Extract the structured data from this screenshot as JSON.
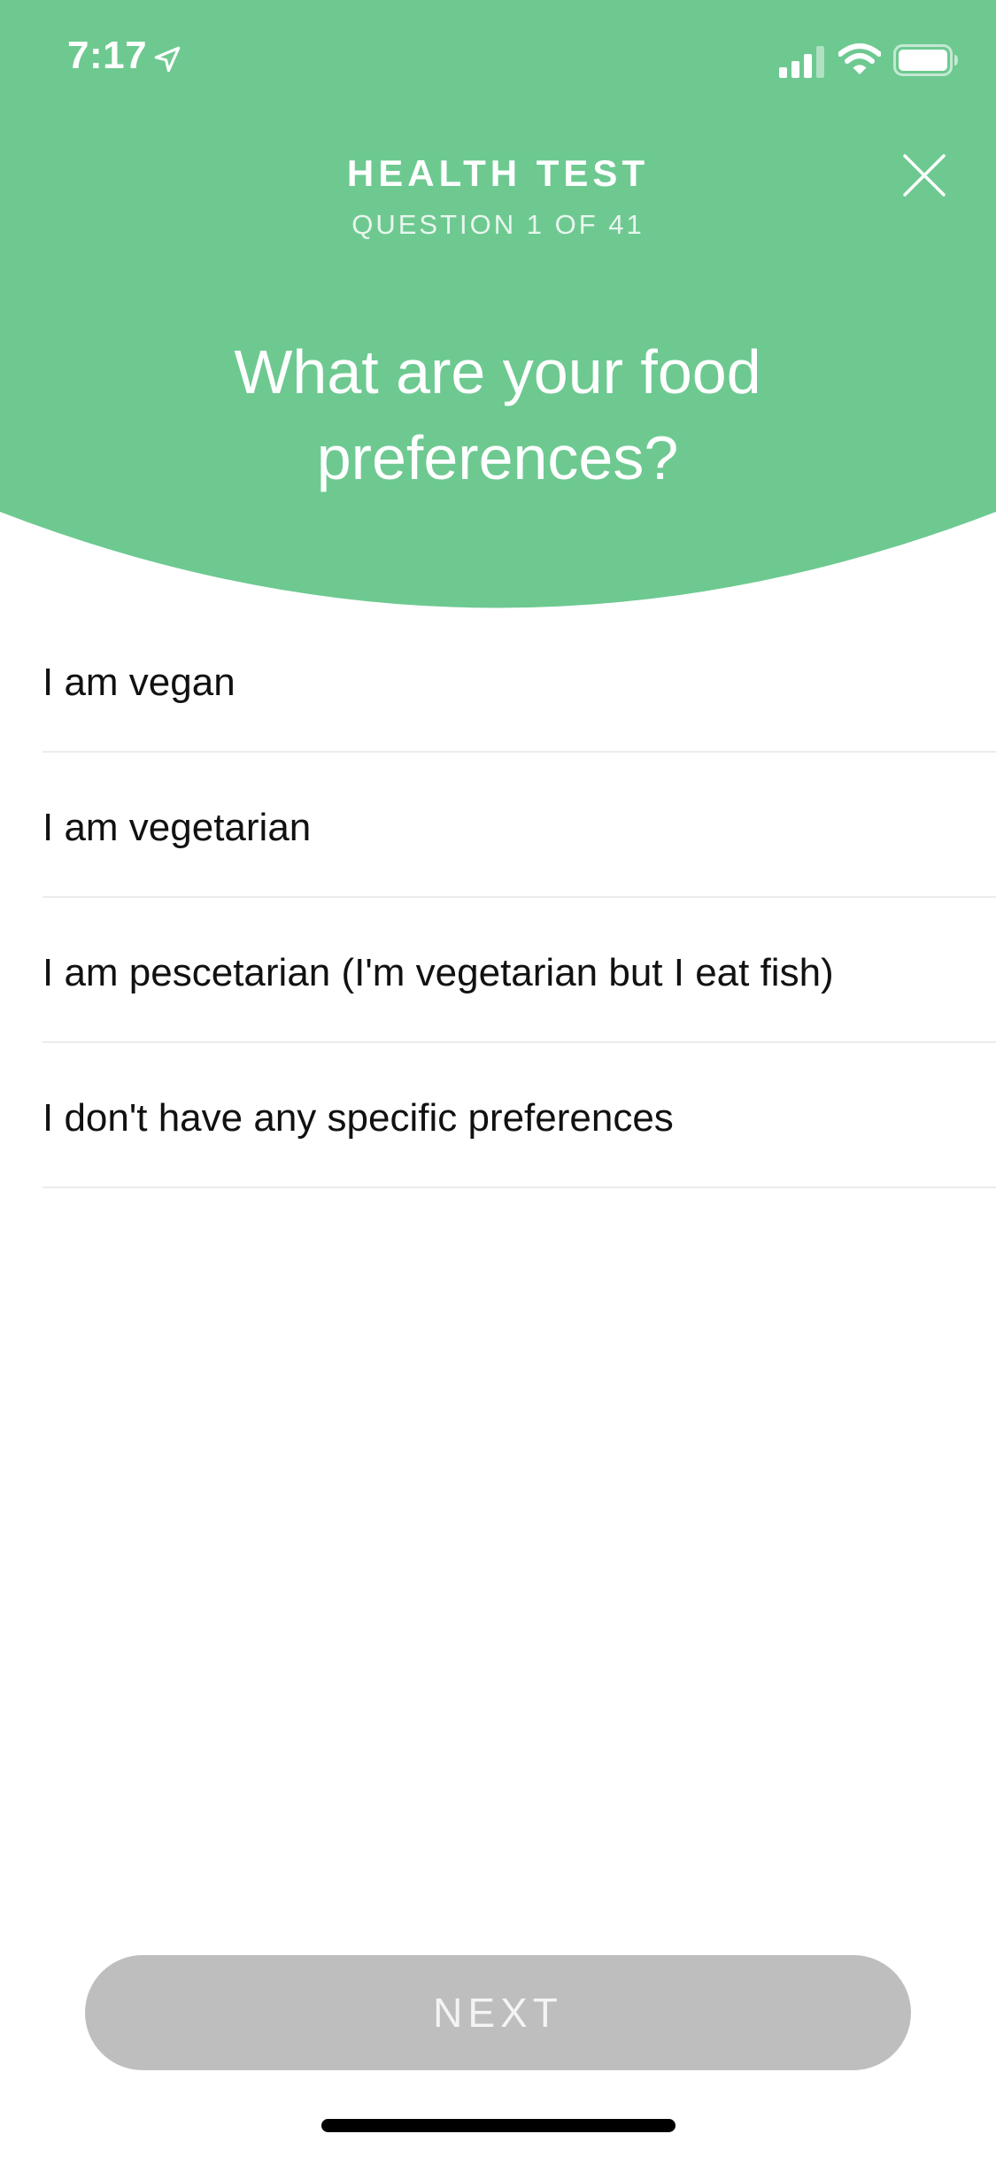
{
  "status_bar": {
    "time": "7:17",
    "icons": [
      "location-arrow-icon",
      "cellular-signal-icon",
      "wifi-icon",
      "battery-icon"
    ]
  },
  "header": {
    "title": "HEALTH TEST",
    "subtitle": "QUESTION 1 OF 41",
    "close_icon": "close-icon"
  },
  "question": {
    "text": "What are your food preferences?"
  },
  "options": [
    {
      "label": "I am vegan"
    },
    {
      "label": "I am vegetarian"
    },
    {
      "label": "I am pescetarian (I'm vegetarian but I eat fish)"
    },
    {
      "label": "I don't have any specific preferences"
    }
  ],
  "footer": {
    "next_label": "NEXT",
    "next_enabled": false
  },
  "colors": {
    "accent": "#6dc990",
    "header_text": "#ffffff",
    "option_text": "#111111",
    "divider": "#ececec",
    "button_disabled_bg": "#bebebe",
    "button_disabled_text": "#f4f4f4"
  }
}
